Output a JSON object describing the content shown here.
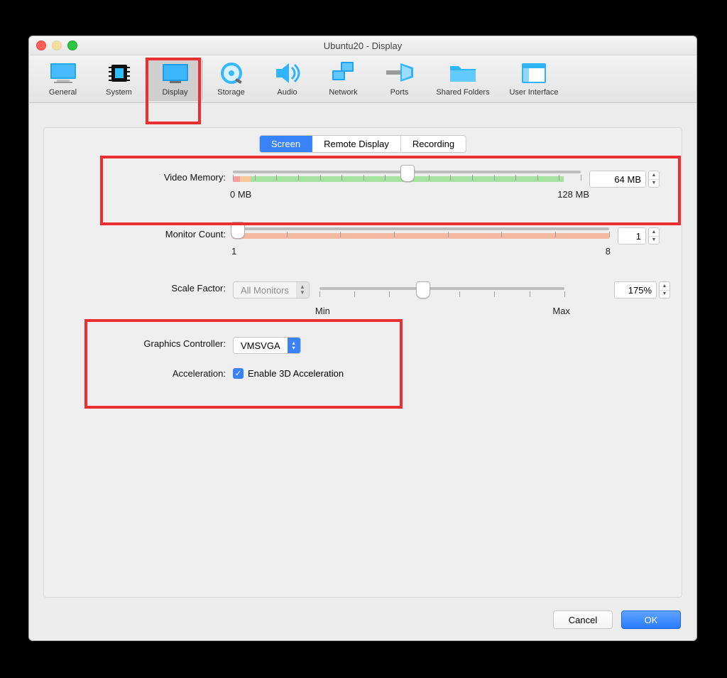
{
  "window": {
    "title": "Ubuntu20 - Display"
  },
  "toolbar": [
    {
      "id": "general",
      "label": "General"
    },
    {
      "id": "system",
      "label": "System"
    },
    {
      "id": "display",
      "label": "Display",
      "active": true
    },
    {
      "id": "storage",
      "label": "Storage"
    },
    {
      "id": "audio",
      "label": "Audio"
    },
    {
      "id": "network",
      "label": "Network"
    },
    {
      "id": "ports",
      "label": "Ports"
    },
    {
      "id": "shared",
      "label": "Shared Folders"
    },
    {
      "id": "ui",
      "label": "User Interface"
    }
  ],
  "tabs": [
    {
      "label": "Screen",
      "active": true
    },
    {
      "label": "Remote Display"
    },
    {
      "label": "Recording"
    }
  ],
  "videoMemory": {
    "label": "Video Memory:",
    "value": "64 MB",
    "minLabel": "0 MB",
    "maxLabel": "128 MB"
  },
  "monitorCount": {
    "label": "Monitor Count:",
    "value": "1",
    "minLabel": "1",
    "maxLabel": "8"
  },
  "scaleFactor": {
    "label": "Scale Factor:",
    "select": "All Monitors",
    "value": "175%",
    "minLabel": "Min",
    "maxLabel": "Max"
  },
  "graphicsController": {
    "label": "Graphics Controller:",
    "value": "VMSVGA"
  },
  "acceleration": {
    "label": "Acceleration:",
    "checkbox": "Enable 3D Acceleration",
    "checked": true
  },
  "buttons": {
    "cancel": "Cancel",
    "ok": "OK"
  }
}
